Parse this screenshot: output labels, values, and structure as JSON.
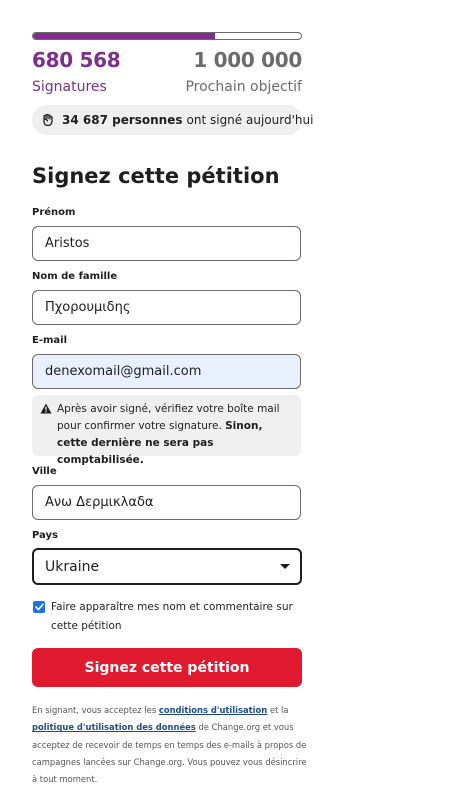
{
  "progress": {
    "current": "680 568",
    "goal": "1 000 000",
    "fraction": 0.68,
    "current_label": "Signatures",
    "goal_label": "Prochain objectif",
    "accent": "#7e2f8e"
  },
  "today": {
    "count": "34 687 personnes",
    "text": "ont signé aujourd'hui",
    "icon": "hand-fist-icon"
  },
  "form": {
    "title": "Signez cette pétition",
    "first_name": {
      "label": "Prénom",
      "value": "Aristos"
    },
    "last_name": {
      "label": "Nom de famille",
      "value": "Πχορουμιδης"
    },
    "email": {
      "label": "E-mail",
      "value": "denexomail@gmail.com"
    },
    "warning": {
      "text": "Après avoir signé, vérifiez votre boîte mail pour confirmer votre signature.",
      "bold": "Sinon, cette dernière ne sera pas comptabilisée.",
      "icon": "warning-icon"
    },
    "city": {
      "label": "Ville",
      "value": "Ανω Δερμικλαδα"
    },
    "country": {
      "label": "Pays",
      "value": "Ukraine"
    },
    "display_checkbox": {
      "label": "Faire apparaître mes nom et commentaire sur cette pétition",
      "checked": true
    },
    "submit_label": "Signez cette pétition",
    "submit_color": "#e01b2f"
  },
  "legal": {
    "part1": "En signant, vous acceptez les",
    "link_terms": "conditions d'utilisation",
    "part2": "et la",
    "link_privacy": "politique d'utilisation des données",
    "part3": "de Change.org et vous acceptez de recevoir de temps en temps des e-mails à propos de campagnes lancées sur Change.org. Vous pouvez vous désincrire à tout moment."
  }
}
